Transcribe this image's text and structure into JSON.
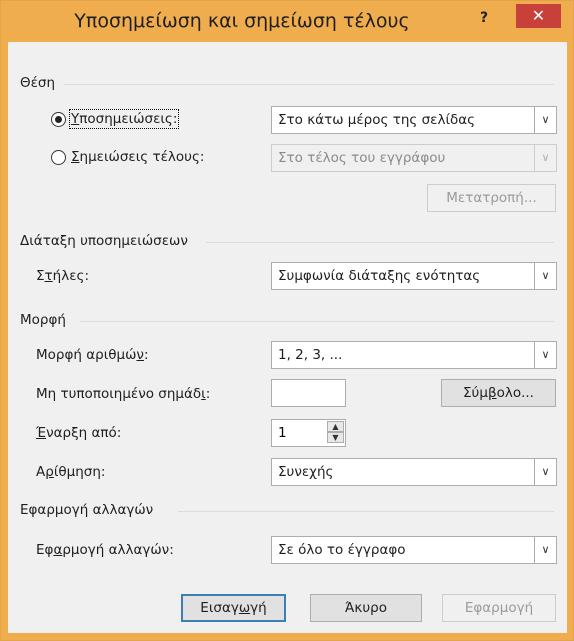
{
  "window": {
    "title": "Υποσημείωση και σημείωση τέλους",
    "help_label": "?",
    "close_label": "✕"
  },
  "location": {
    "section_label": "Θέση",
    "footnotes": {
      "label_pre": "",
      "label_u": "Υ",
      "label_post": "ποσημειώσεις:",
      "selected": true,
      "value": "Στο κάτω μέρος της σελίδας"
    },
    "endnotes": {
      "label_pre": "",
      "label_u": "Σ",
      "label_post": "ημειώσεις τέλους:",
      "selected": false,
      "value": "Στο τέλος του εγγράφου"
    },
    "convert_button": "Μετατροπή..."
  },
  "layout": {
    "section_label": "Διάταξη υποσημειώσεων",
    "columns": {
      "label_pre": "Σ",
      "label_u": "τ",
      "label_post": "ήλες:",
      "value": "Συμφωνία διάταξης ενότητας"
    }
  },
  "format": {
    "section_label": "Μορφή",
    "number_format": {
      "label_pre": "Μορφή αριθμώ",
      "label_u": "ν",
      "label_post": ":",
      "value": "1, 2, 3, ..."
    },
    "custom_mark": {
      "label_pre": "Μη τυποποιημένο σημάδ",
      "label_u": "ι",
      "label_post": ":",
      "value": ""
    },
    "symbol_button": {
      "pre": "Σύμ",
      "u": "β",
      "post": "ολο..."
    },
    "start_at": {
      "label_pre": "",
      "label_u": "Έ",
      "label_post": "ναρξη από:",
      "value": "1"
    },
    "numbering": {
      "label_pre": "Α",
      "label_u": "ρ",
      "label_post": "ίθμηση:",
      "value": "Συνεχής"
    }
  },
  "apply": {
    "section_label": "Εφαρμογή αλλαγών",
    "apply_changes": {
      "label_pre": "Εφ",
      "label_u": "α",
      "label_post": "ρμογή αλλαγών:",
      "value": "Σε όλο το έγγραφο"
    }
  },
  "buttons": {
    "insert": {
      "pre": "Εισαγ",
      "u": "ω",
      "post": "γή"
    },
    "cancel": "Άκυρο",
    "apply": "Εφαρμογή"
  },
  "icons": {
    "dropdown": "chevron-down-icon",
    "spin_up": "spin-up-icon",
    "spin_down": "spin-down-icon"
  }
}
